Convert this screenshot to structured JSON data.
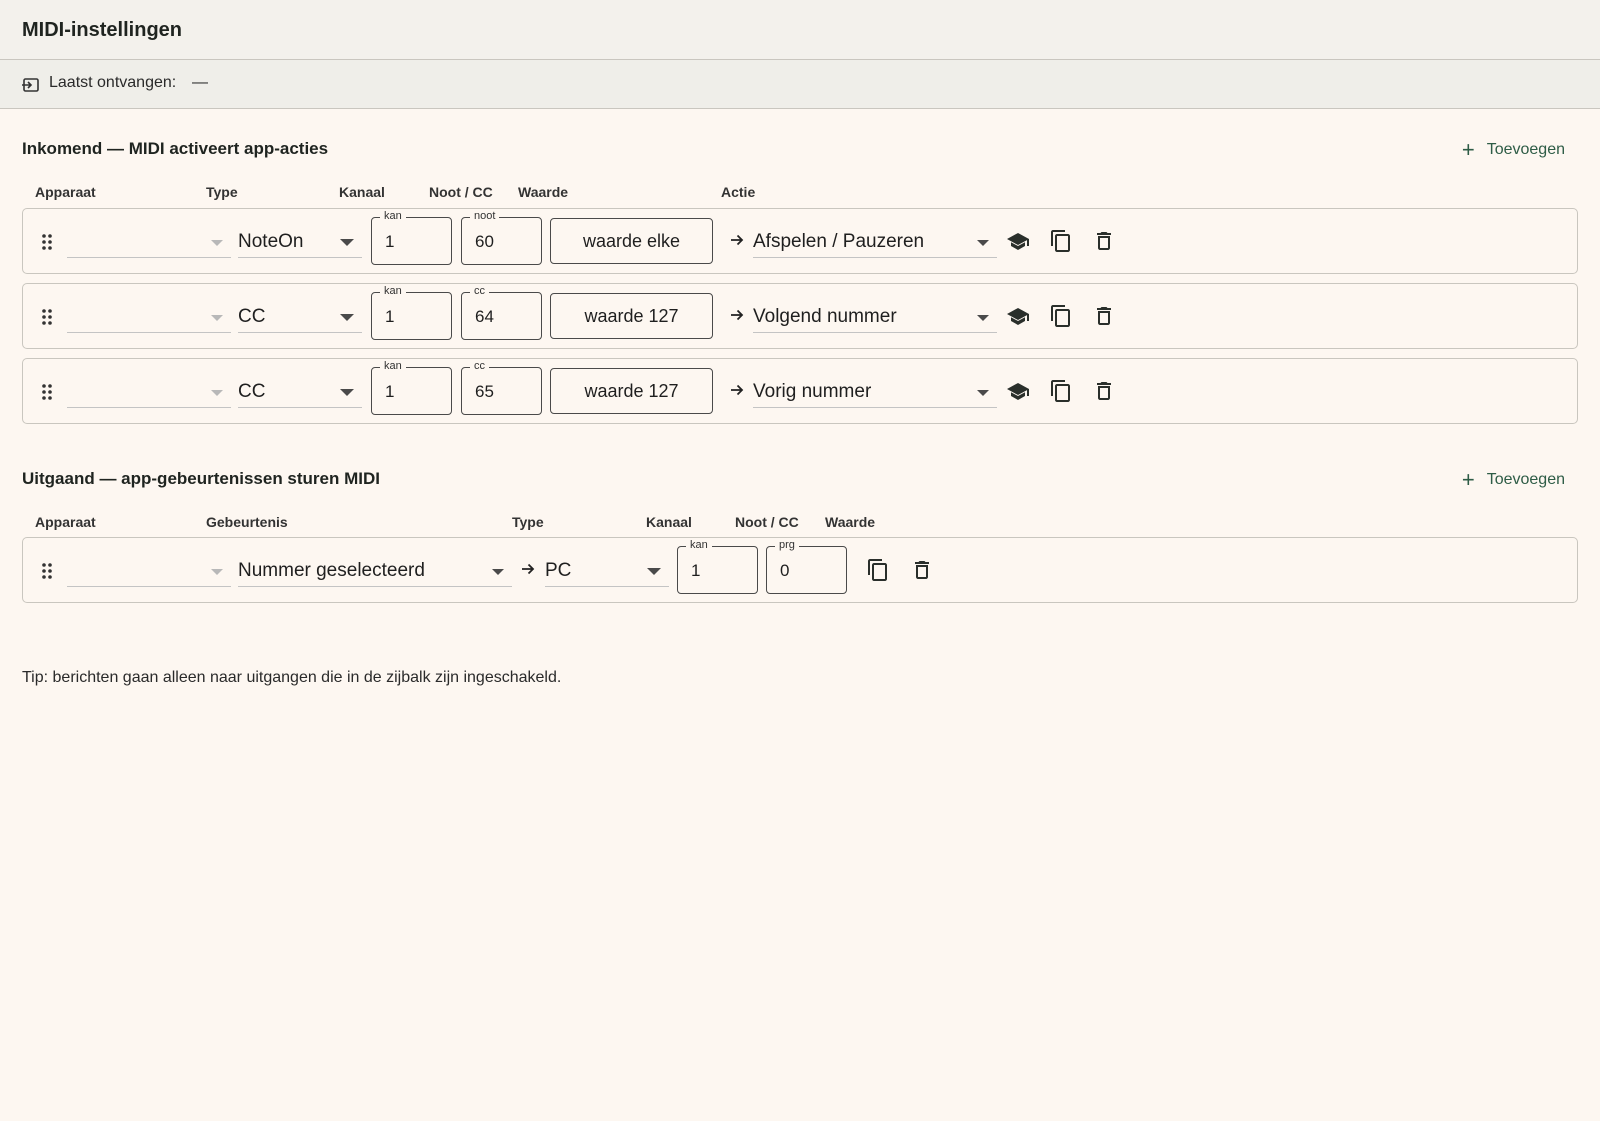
{
  "header": {
    "title": "MIDI-instellingen"
  },
  "status": {
    "label": "Laatst ontvangen:",
    "value": "—",
    "icon": "input-icon"
  },
  "incoming": {
    "title": "Inkomend — MIDI activeert app-acties",
    "add_label": "Toevoegen",
    "columns": {
      "device": "Apparaat",
      "type": "Type",
      "channel": "Kanaal",
      "note": "Noot / CC",
      "value": "Waarde",
      "action": "Actie"
    },
    "rows": [
      {
        "device": "",
        "type": "NoteOn",
        "channel_legend": "kan",
        "channel": "1",
        "num_legend": "noot",
        "num": "60",
        "value": "waarde elke",
        "action": "Afspelen / Pauzeren"
      },
      {
        "device": "",
        "type": "CC",
        "channel_legend": "kan",
        "channel": "1",
        "num_legend": "cc",
        "num": "64",
        "value": "waarde 127",
        "action": "Volgend nummer"
      },
      {
        "device": "",
        "type": "CC",
        "channel_legend": "kan",
        "channel": "1",
        "num_legend": "cc",
        "num": "65",
        "value": "waarde 127",
        "action": "Vorig nummer"
      }
    ]
  },
  "outgoing": {
    "title": "Uitgaand — app-gebeurtenissen sturen MIDI",
    "add_label": "Toevoegen",
    "columns": {
      "device": "Apparaat",
      "event": "Gebeurtenis",
      "type": "Type",
      "channel": "Kanaal",
      "note": "Noot / CC",
      "value": "Waarde"
    },
    "rows": [
      {
        "device": "",
        "event": "Nummer geselecteerd",
        "type": "PC",
        "channel_legend": "kan",
        "channel": "1",
        "num_legend": "prg",
        "num": "0"
      }
    ]
  },
  "tip": "Tip: berichten gaan alleen naar uitgangen die in de zijbalk zijn ingeschakeld.",
  "colors": {
    "accent": "#2e5c46",
    "background": "#fdf7f1",
    "border": "#c9c6bf"
  }
}
